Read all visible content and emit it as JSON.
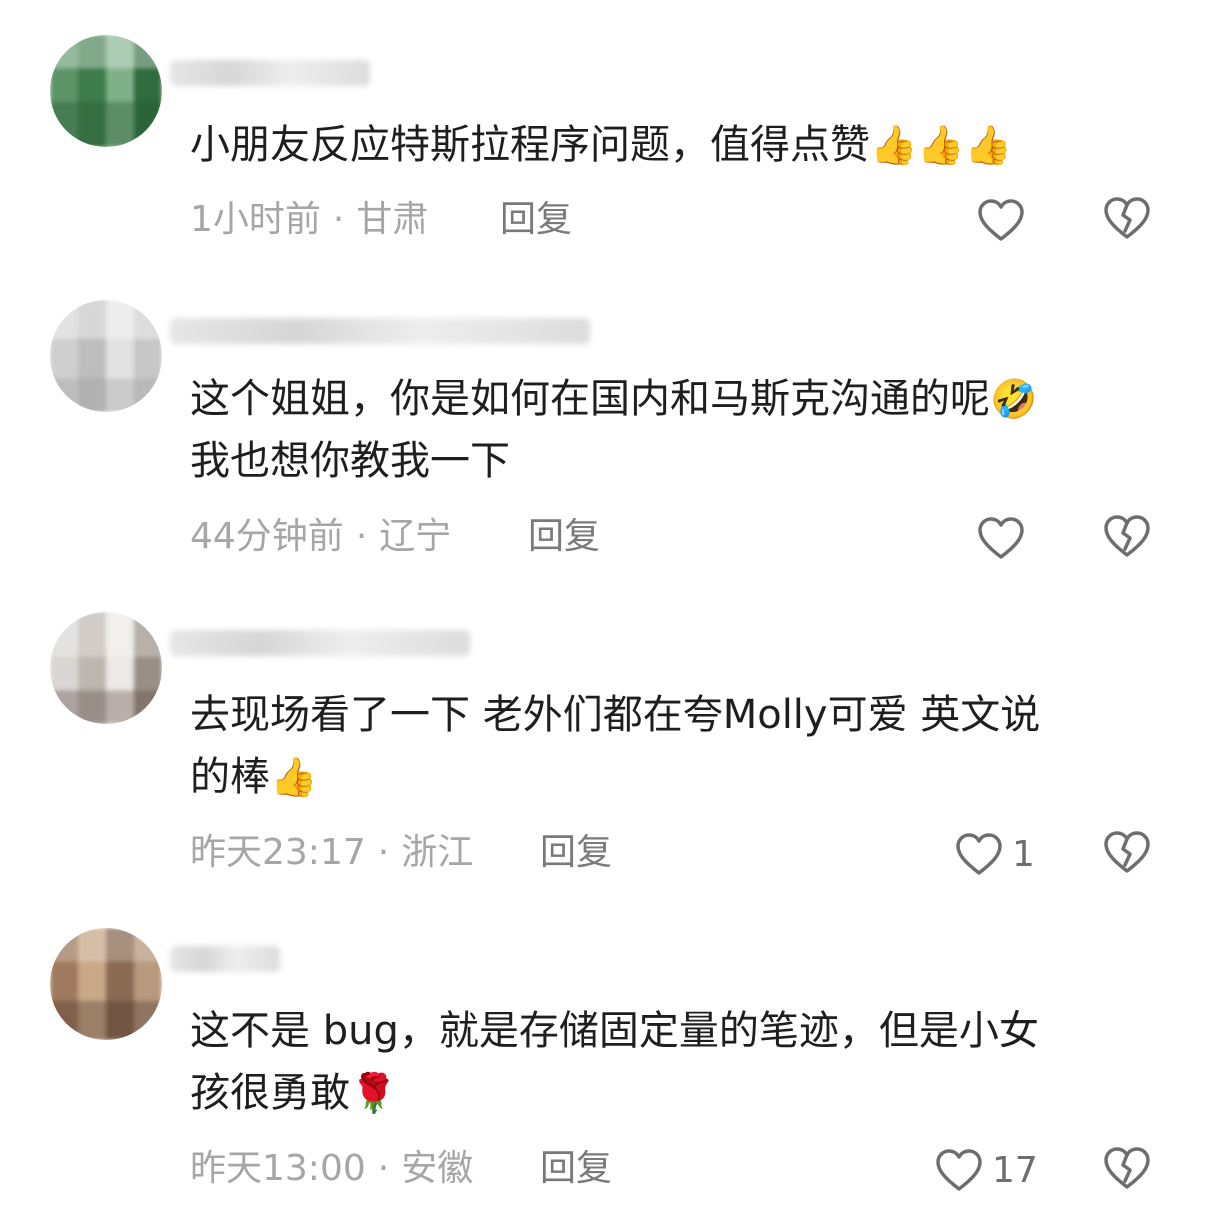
{
  "comments": [
    {
      "lines": [
        "小朋友反应特斯拉程序问题，值得点赞"
      ],
      "emoji_after": "👍👍👍",
      "time": "1小时前",
      "location": "甘肃",
      "reply_label": "回复",
      "like_count": ""
    },
    {
      "lines": [
        "这个姐姐，你是如何在国内和马斯克沟通的呢",
        "我也想你教我一下"
      ],
      "emoji_after": "🤣",
      "time": "44分钟前",
      "location": "辽宁",
      "reply_label": "回复",
      "like_count": ""
    },
    {
      "lines": [
        "去现场看了一下 老外们都在夸Molly可爱 英文说",
        "的棒"
      ],
      "emoji_after": "👍",
      "time": "昨天23:17",
      "location": "浙江",
      "reply_label": "回复",
      "like_count": "1"
    },
    {
      "lines": [
        "这不是 bug，就是存储固定量的笔迹，但是小女",
        "孩很勇敢"
      ],
      "emoji_after": "🌹",
      "time": "昨天13:00",
      "location": "安徽",
      "reply_label": "回复",
      "like_count": "17"
    }
  ],
  "separator": "·",
  "icons": {
    "like": "heart-outline-icon",
    "dislike": "broken-heart-icon"
  }
}
